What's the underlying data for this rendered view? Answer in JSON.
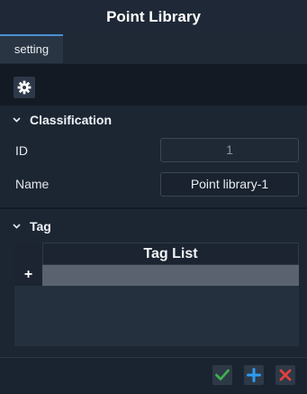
{
  "window": {
    "title": "Point Library"
  },
  "tabs": [
    {
      "label": "setting"
    }
  ],
  "toolbar": {
    "settings_icon": "gear-icon"
  },
  "classification": {
    "header": "Classification",
    "fields": [
      {
        "label": "ID",
        "value": "1"
      },
      {
        "label": "Name",
        "value": "Point library-1"
      }
    ]
  },
  "tag": {
    "header": "Tag",
    "table_header": "Tag List",
    "add_symbol": "+"
  },
  "footer": {
    "confirm_icon": "check-icon",
    "add_icon": "plus-icon",
    "delete_icon": "close-icon",
    "colors": {
      "confirm": "#3fae4f",
      "add": "#2e9bf0",
      "delete": "#e0413a"
    }
  }
}
